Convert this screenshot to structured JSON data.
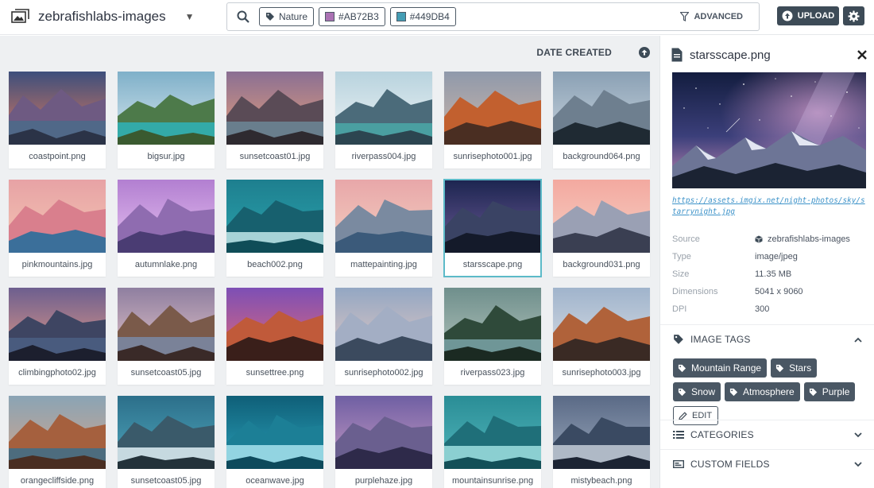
{
  "header": {
    "source_name": "zebrafishlabs-images",
    "search_chips": [
      {
        "type": "tag",
        "label": "Nature"
      },
      {
        "type": "color",
        "label": "#AB72B3",
        "color": "#AB72B3"
      },
      {
        "type": "color",
        "label": "#449DB4",
        "color": "#449DB4"
      }
    ],
    "advanced_label": "ADVANCED",
    "upload_label": "UPLOAD"
  },
  "sort": {
    "label": "DATE CREATED"
  },
  "images": [
    {
      "name": "coastpoint.png"
    },
    {
      "name": "bigsur.jpg"
    },
    {
      "name": "sunsetcoast01.jpg"
    },
    {
      "name": "riverpass004.jpg"
    },
    {
      "name": "sunrisephoto001.jpg"
    },
    {
      "name": "background064.png"
    },
    {
      "name": "pinkmountains.jpg"
    },
    {
      "name": "autumnlake.png"
    },
    {
      "name": "beach002.png"
    },
    {
      "name": "mattepainting.jpg"
    },
    {
      "name": "starsscape.png",
      "selected": true
    },
    {
      "name": "background031.png"
    },
    {
      "name": "climbingphoto02.jpg"
    },
    {
      "name": "sunsetcoast05.jpg"
    },
    {
      "name": "sunsettree.png"
    },
    {
      "name": "sunrisephoto002.jpg"
    },
    {
      "name": "riverpass023.jpg"
    },
    {
      "name": "sunrisephoto003.jpg"
    },
    {
      "name": "orangecliffside.png"
    },
    {
      "name": "sunsetcoast05.jpg"
    },
    {
      "name": "oceanwave.jpg"
    },
    {
      "name": "purplehaze.jpg"
    },
    {
      "name": "mountainsunrise.png"
    },
    {
      "name": "mistybeach.png"
    }
  ],
  "detail": {
    "filename": "starsscape.png",
    "url": "https://assets.imgix.net/night-photos/sky/starrynight.jpg",
    "meta": [
      {
        "key": "Source",
        "value": "zebrafishlabs-images",
        "icon": "cube-icon"
      },
      {
        "key": "Type",
        "value": "image/jpeg"
      },
      {
        "key": "Size",
        "value": "11.35 MB"
      },
      {
        "key": "Dimensions",
        "value": "5041 x 9060"
      },
      {
        "key": "DPI",
        "value": "300"
      }
    ],
    "tags_title": "IMAGE TAGS",
    "tags": [
      "Mountain Range",
      "Stars",
      "Snow",
      "Atmosphere",
      "Purple"
    ],
    "edit_label": "EDIT",
    "categories_title": "CATEGORIES",
    "custom_fields_title": "CUSTOM FIELDS"
  }
}
